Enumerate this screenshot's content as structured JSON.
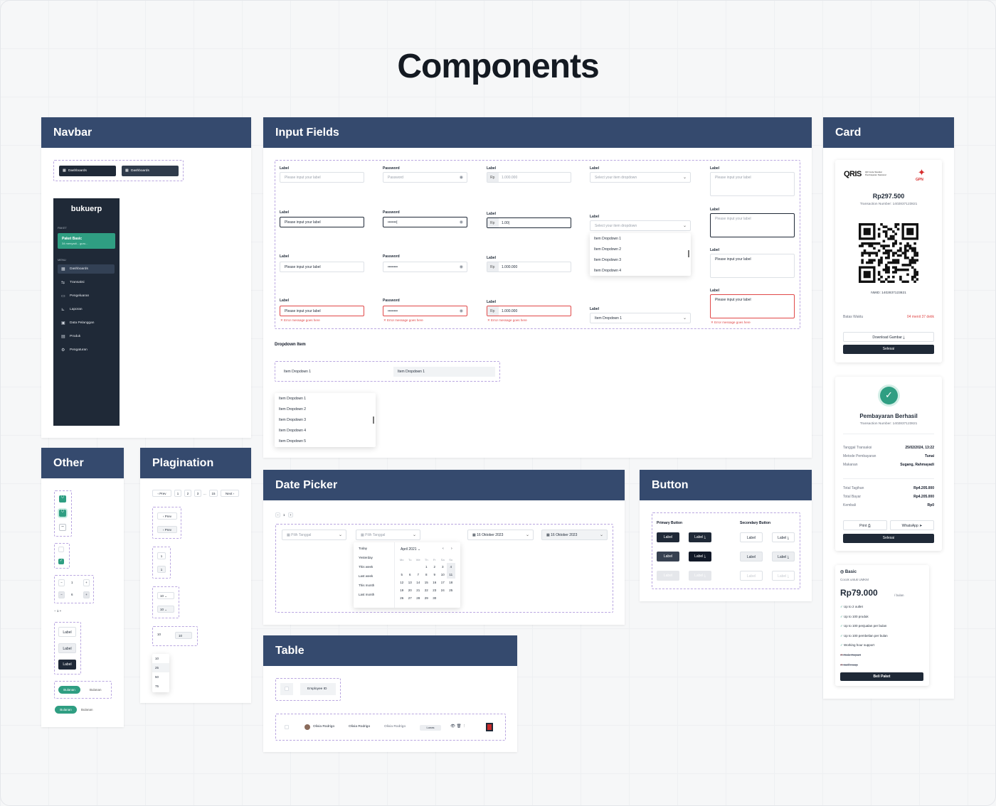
{
  "title": "Components",
  "navbar": {
    "header": "Navbar",
    "pill1": "Dashboards",
    "pill2": "Dashboards",
    "logo": "bukuerp",
    "paket_label": "PAKET",
    "paket_name": "Paket Basic",
    "paket_sub": "34 menyadi... guru...",
    "menu_label": "MENU",
    "items": [
      "Dashboards",
      "Transaksi",
      "Pengeluaran",
      "Laporan",
      "Data Pelanggan",
      "Produk",
      "Pengaturan"
    ]
  },
  "input": {
    "header": "Input Fields",
    "label": "Label",
    "password": "Password",
    "placeholder": "Please input your label",
    "pw_placeholder": "Password",
    "rp": "Rp",
    "amount_ph": "1.000.000",
    "amount_typed": "1.00|",
    "amount": "1.000.000",
    "dd_ph": "Select your item dropdown",
    "dd_value": "Item Dropdown 1",
    "pw_dots": "••••••••",
    "pw_typed": "•••••••|",
    "error": "Error message goes here",
    "dd_items": [
      "Item Dropdown 1",
      "Item Dropdown 2",
      "Item Dropdown 3",
      "Item Dropdown 4"
    ],
    "dropdown_item_title": "Dropdown Item",
    "dd_item_a": "Item Dropdown 1",
    "dd_item_b": "Item Dropdown 1",
    "dd_items5": [
      "Item Dropdown 1",
      "Item Dropdown 2",
      "Item Dropdown 3",
      "Item Dropdown 4",
      "Item Dropdown 5"
    ]
  },
  "card": {
    "header": "Card",
    "qris_sub": "QR Code Standar Pembayaran Nasional",
    "gpn": "GPN",
    "amount": "Rp297.500",
    "trx": "Transaction Number: 1402837123821",
    "nmid": "NMID: 1402837123821",
    "batas": "Batas Waktu",
    "countdown": "04 menit 37 detik",
    "download": "Download Gambar",
    "selesai": "Selesai",
    "success_title": "Pembayaran Berhasil",
    "success_trx": "Transaction Number: 1402837123821",
    "rows1": [
      [
        "Tanggal Transaksi",
        "25/02/2024, 13:22"
      ],
      [
        "Metode Pembayaran",
        "Tunai"
      ],
      [
        "Makanan",
        "Sugang, Rahmayadi"
      ]
    ],
    "rows2": [
      [
        "Total Tagihan",
        "Rp4.205.000"
      ],
      [
        "Total Bayar",
        "Rp4.205.000"
      ],
      [
        "Kembali",
        "Rp0"
      ]
    ],
    "print": "Print",
    "whatsapp": "WhatsApp",
    "selesai2": "Selesai",
    "plan_name": "Basic",
    "plan_sub": "Cocok untuk UMKM",
    "plan_price": "Rp79.000",
    "plan_per": "/ bulan",
    "plan_features": [
      "Up to 2 outlet",
      "Up to 100 produk",
      "Up to 100 penjualan per bulan",
      "Up to 100 pembelian per bulan",
      "Working hour support"
    ],
    "plan_x": [
      "Role Report",
      "Self-Hosp"
    ],
    "beli": "Beli Paket"
  },
  "other": {
    "header": "Other",
    "stepper": "1",
    "stepper2": "6",
    "stepper3": "1",
    "label": "Label",
    "tab_a": "Bulanan",
    "tab_b": "Bulanan"
  },
  "pagination": {
    "header": "Plagination",
    "prev": "Prev",
    "pages": [
      "1",
      "2",
      "3",
      "...",
      "15"
    ],
    "next": "Next",
    "one": "1",
    "ten": "10",
    "opts": [
      "10",
      "25",
      "50",
      "75"
    ]
  },
  "datepicker": {
    "header": "Date Picker",
    "ph": "Pilih Tanggal",
    "date1": "16 Oktober 2023",
    "date2": "16 Oktober 2023",
    "quick": [
      "Today",
      "Yesterday",
      "This week",
      "Last week",
      "This month",
      "Last month"
    ],
    "month": "April 2021",
    "days": [
      "Mo",
      "Tu",
      "We",
      "Th",
      "Fr",
      "Sa",
      "Su"
    ],
    "weeks": [
      [
        "",
        "",
        "",
        "1",
        "2",
        "3",
        "4"
      ],
      [
        "5",
        "6",
        "7",
        "8",
        "9",
        "10",
        "11"
      ],
      [
        "12",
        "13",
        "14",
        "15",
        "16",
        "17",
        "18"
      ],
      [
        "19",
        "20",
        "21",
        "22",
        "23",
        "24",
        "25"
      ],
      [
        "26",
        "27",
        "28",
        "29",
        "30",
        "",
        ""
      ]
    ],
    "mini": "1"
  },
  "button": {
    "header": "Button",
    "primary": "Primary Button",
    "secondary": "Secondary Button",
    "label": "Label"
  },
  "table": {
    "header": "Table",
    "col": "Employee ID",
    "name": "Olivia Rodrigo",
    "name2": "Olivia Rodrigo",
    "name3": "Olivia Rodrigo",
    "badge": "Lunas"
  }
}
